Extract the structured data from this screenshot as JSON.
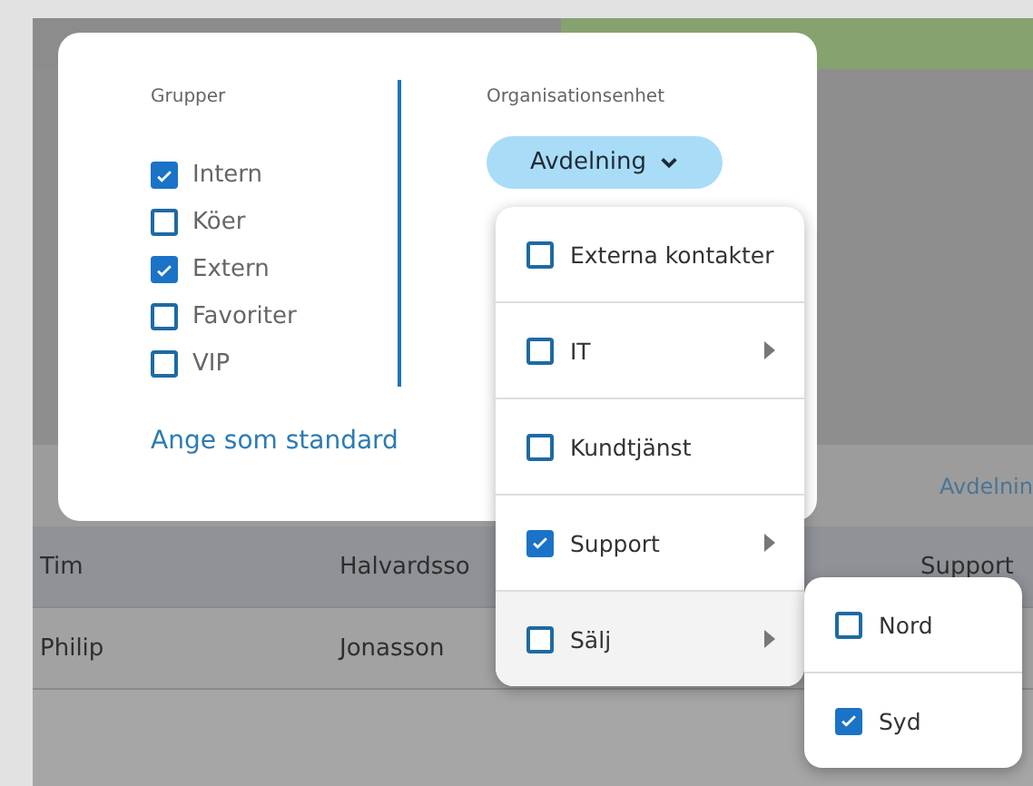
{
  "background": {
    "header": [
      "Avdelnin"
    ],
    "rows": [
      {
        "cells": [
          "Tim",
          "Halvardsso",
          "Support"
        ]
      },
      {
        "cells": [
          "Philip",
          "Jonasson",
          ""
        ]
      }
    ]
  },
  "filter_popup": {
    "groups": {
      "title": "Grupper",
      "items": [
        {
          "label": "Intern",
          "checked": true
        },
        {
          "label": "Köer",
          "checked": false
        },
        {
          "label": "Extern",
          "checked": true
        },
        {
          "label": "Favoriter",
          "checked": false
        },
        {
          "label": "VIP",
          "checked": false
        }
      ]
    },
    "set_default_link": "Ange som standard",
    "org_unit": {
      "title": "Organisationsenhet",
      "button": "Avdelning"
    }
  },
  "dropdown": {
    "items": [
      {
        "label": "Externa kontakter",
        "checked": false,
        "has_submenu": false,
        "hovered": false
      },
      {
        "label": "IT",
        "checked": false,
        "has_submenu": true,
        "hovered": false
      },
      {
        "label": "Kundtjänst",
        "checked": false,
        "has_submenu": false,
        "hovered": false
      },
      {
        "label": "Support",
        "checked": true,
        "has_submenu": true,
        "hovered": false
      },
      {
        "label": "Sälj",
        "checked": false,
        "has_submenu": true,
        "hovered": true
      }
    ]
  },
  "submenu": {
    "items": [
      {
        "label": "Nord",
        "checked": false
      },
      {
        "label": "Syd",
        "checked": true
      }
    ]
  }
}
